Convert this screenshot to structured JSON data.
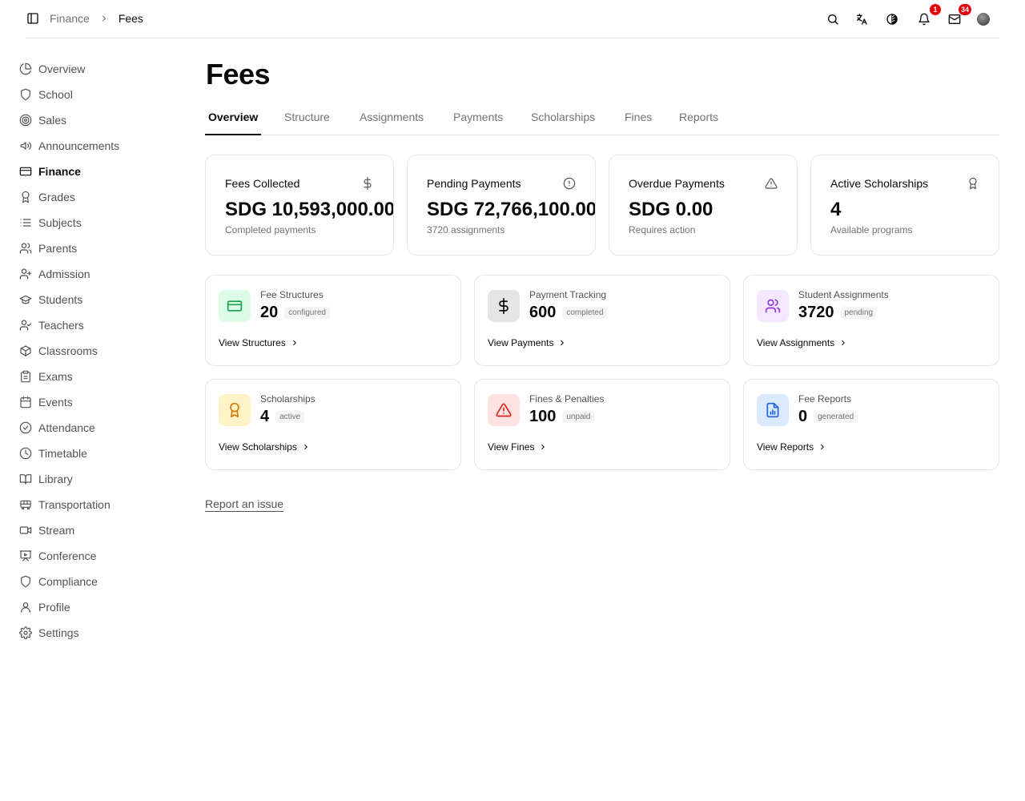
{
  "breadcrumb": {
    "parent": "Finance",
    "current": "Fees"
  },
  "header": {
    "notifications_count": "1",
    "messages_count": "34"
  },
  "sidebar": {
    "items": [
      {
        "label": "Overview",
        "icon": "chart-pie-icon"
      },
      {
        "label": "School",
        "icon": "shield-icon"
      },
      {
        "label": "Sales",
        "icon": "target-icon"
      },
      {
        "label": "Announcements",
        "icon": "megaphone-icon"
      },
      {
        "label": "Finance",
        "icon": "credit-card-icon",
        "active": true
      },
      {
        "label": "Grades",
        "icon": "award-icon"
      },
      {
        "label": "Subjects",
        "icon": "list-icon"
      },
      {
        "label": "Parents",
        "icon": "users-icon"
      },
      {
        "label": "Admission",
        "icon": "user-plus-icon"
      },
      {
        "label": "Students",
        "icon": "graduation-cap-icon"
      },
      {
        "label": "Teachers",
        "icon": "user-check-icon"
      },
      {
        "label": "Classrooms",
        "icon": "box-icon"
      },
      {
        "label": "Exams",
        "icon": "clipboard-icon"
      },
      {
        "label": "Events",
        "icon": "calendar-icon"
      },
      {
        "label": "Attendance",
        "icon": "check-circle-icon"
      },
      {
        "label": "Timetable",
        "icon": "clock-icon"
      },
      {
        "label": "Library",
        "icon": "book-open-icon"
      },
      {
        "label": "Transportation",
        "icon": "bus-icon"
      },
      {
        "label": "Stream",
        "icon": "video-icon"
      },
      {
        "label": "Conference",
        "icon": "presentation-icon"
      },
      {
        "label": "Compliance",
        "icon": "shield-icon"
      },
      {
        "label": "Profile",
        "icon": "user-icon"
      },
      {
        "label": "Settings",
        "icon": "gear-icon"
      }
    ]
  },
  "page": {
    "title": "Fees"
  },
  "tabs": [
    "Overview",
    "Structure",
    "Assignments",
    "Payments",
    "Scholarships",
    "Fines",
    "Reports"
  ],
  "stats": [
    {
      "title": "Fees Collected",
      "value": "SDG 10,593,000.00",
      "sub": "Completed payments",
      "icon": "dollar-icon"
    },
    {
      "title": "Pending Payments",
      "value": "SDG 72,766,100.00",
      "sub": "3720 assignments",
      "icon": "alert-circle-icon"
    },
    {
      "title": "Overdue Payments",
      "value": "SDG 0.00",
      "sub": "Requires action",
      "icon": "alert-triangle-icon"
    },
    {
      "title": "Active Scholarships",
      "value": "4",
      "sub": "Available programs",
      "icon": "award-icon"
    }
  ],
  "features": [
    {
      "title": "Fee Structures",
      "count": "20",
      "pill": "configured",
      "link": "View Structures",
      "icon": "credit-card-icon",
      "accent": "#16a34a",
      "bg": "#dcfce7"
    },
    {
      "title": "Payment Tracking",
      "count": "600",
      "pill": "completed",
      "link": "View Payments",
      "icon": "dollar-icon",
      "accent": "#0a0a0a",
      "bg": "#e5e5e5"
    },
    {
      "title": "Student Assignments",
      "count": "3720",
      "pill": "pending",
      "link": "View Assignments",
      "icon": "users-icon",
      "accent": "#9333ea",
      "bg": "#f3e8ff"
    },
    {
      "title": "Scholarships",
      "count": "4",
      "pill": "active",
      "link": "View Scholarships",
      "icon": "award-icon",
      "accent": "#d97706",
      "bg": "#fef3c7"
    },
    {
      "title": "Fines & Penalties",
      "count": "100",
      "pill": "unpaid",
      "link": "View Fines",
      "icon": "alert-triangle-icon",
      "accent": "#dc2626",
      "bg": "#fee2e2"
    },
    {
      "title": "Fee Reports",
      "count": "0",
      "pill": "generated",
      "link": "View Reports",
      "icon": "file-chart-icon",
      "accent": "#2563eb",
      "bg": "#dbeafe"
    }
  ],
  "footer": {
    "report_issue": "Report an issue"
  }
}
